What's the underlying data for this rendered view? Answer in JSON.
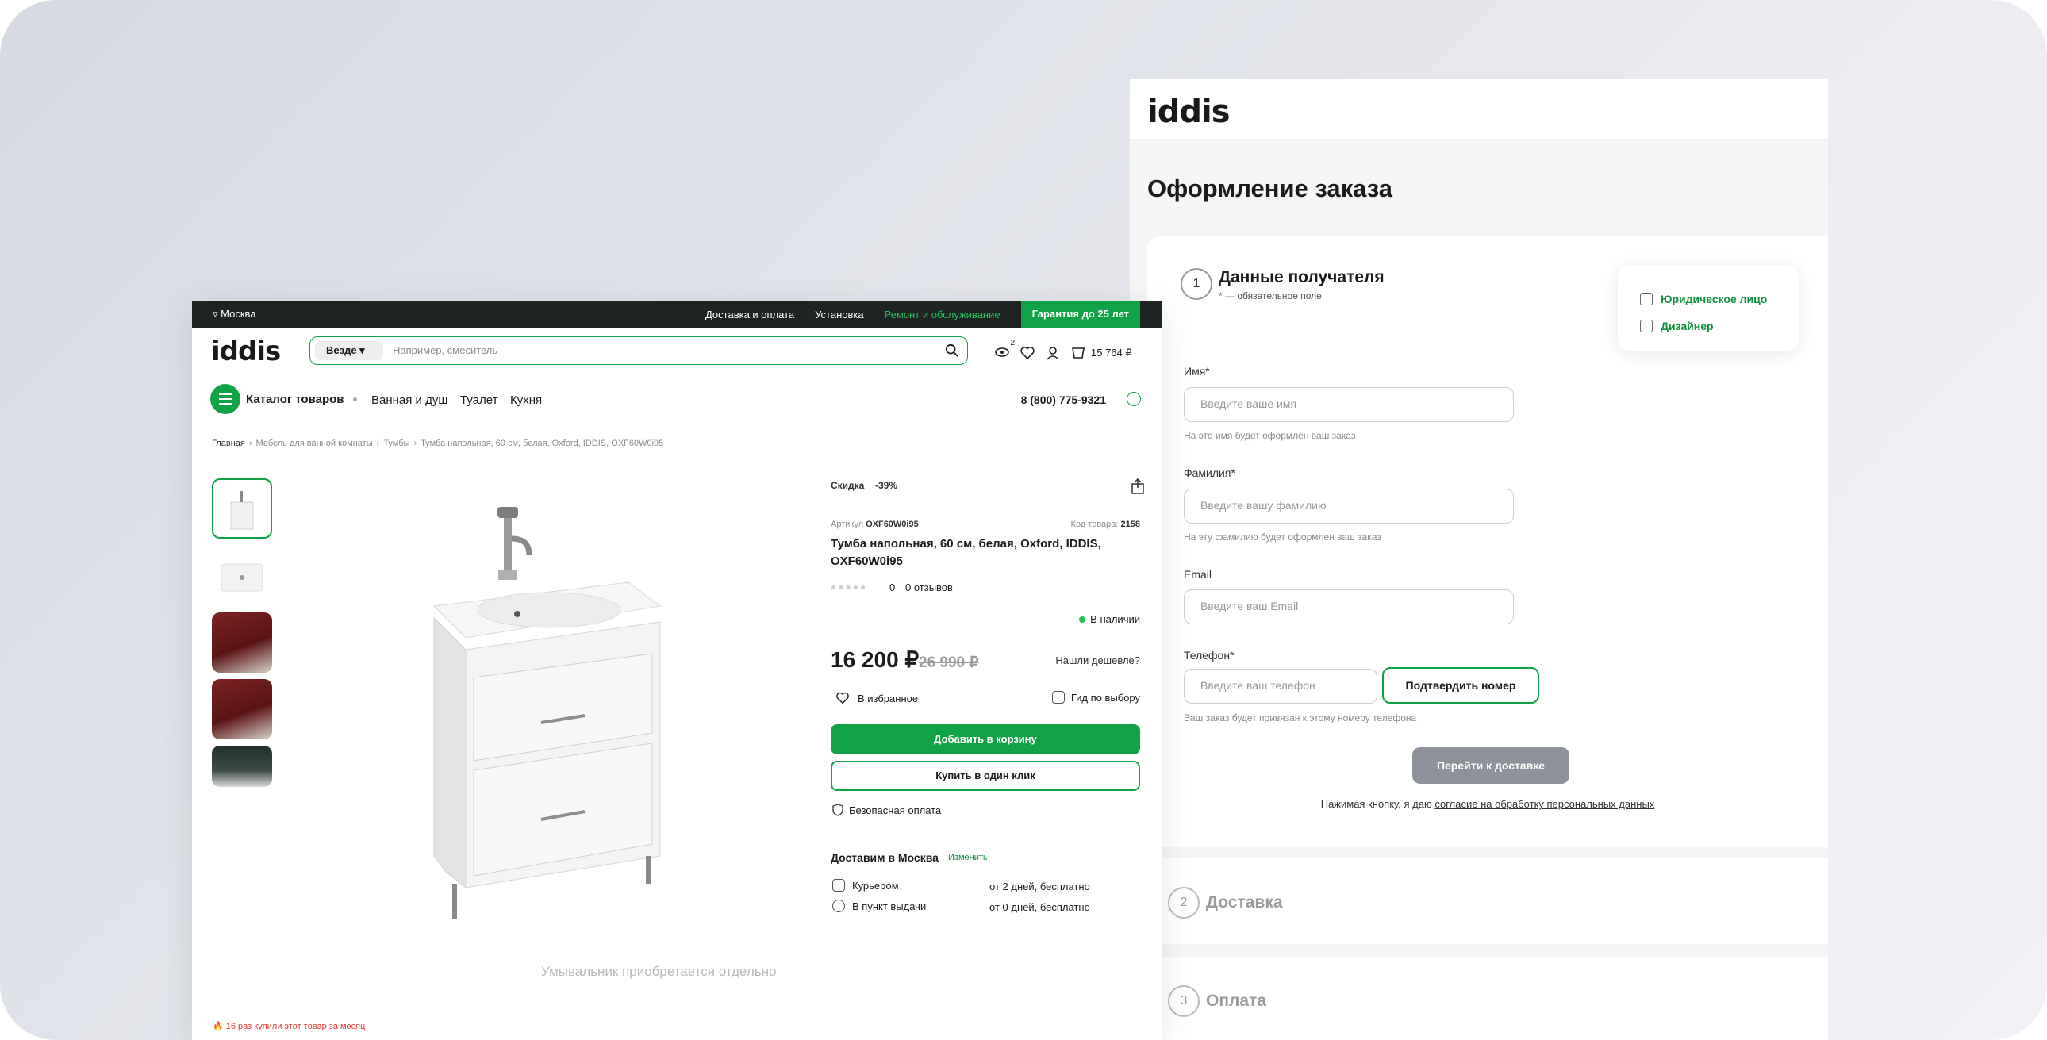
{
  "checkout": {
    "logo": "iddis",
    "title": "Оформление заказа",
    "step1": {
      "num": "1",
      "title": "Данные получателя",
      "required_note": "* — обязательное поле"
    },
    "entity": {
      "legal": "Юридическое лицо",
      "designer": "Дизайнер"
    },
    "fields": {
      "name_label": "Имя*",
      "name_placeholder": "Введите ваше имя",
      "name_hint": "На это имя будет оформлен ваш заказ",
      "surname_label": "Фамилия*",
      "surname_placeholder": "Введите вашу фамилию",
      "surname_hint": "На эту фамилию будет оформлен ваш заказ",
      "email_label": "Email",
      "email_placeholder": "Введите ваш Email",
      "phone_label": "Телефон*",
      "phone_placeholder": "Введите ваш телефон",
      "phone_hint": "Ваш заказ будет привязан к этому номеру телефона"
    },
    "confirm_button": "Подтвердить номер",
    "next_button": "Перейти к доставке",
    "consent_prefix": "Нажимая кнопку, я даю ",
    "consent_link": "согласие на обработку персональных данных",
    "step2": {
      "num": "2",
      "title": "Доставка"
    },
    "step3": {
      "num": "3",
      "title": "Оплата"
    }
  },
  "product_page": {
    "topbar": {
      "city": "Москва",
      "links": [
        "Доставка и оплата",
        "Установка"
      ],
      "service": "Ремонт и обслуживание",
      "warranty": "Гарантия до 25 лет"
    },
    "header": {
      "logo": "iddis",
      "search_scope": "Везде",
      "search_placeholder": "Например, смеситель",
      "compare_count": "2",
      "cart_total": "15 764 ₽"
    },
    "nav": {
      "catalog": "Каталог товаров",
      "links": [
        "Ванная и душ",
        "Туалет",
        "Кухня"
      ],
      "phone": "8 (800) 775-9321"
    },
    "breadcrumbs": [
      "Главная",
      "Мебель для ванной комнаты",
      "Тумбы",
      "Тумба напольная, 60 см, белая, Oxford, IDDIS, OXF60W0i95"
    ],
    "image_note": "Умывальник приобретается отдельно",
    "bought_note": "16 раз купили этот товар за месяц",
    "info": {
      "badge_sale": "Скидка",
      "badge_pct": "-39%",
      "article_label": "Артикул",
      "article": "OXF60W0i95",
      "code_label": "Код товара:",
      "code": "2158",
      "title": "Тумба напольная, 60 см, белая, Oxford, IDDIS, OXF60W0i95",
      "rating": "0",
      "reviews": "0 отзывов",
      "stock": "В наличии",
      "price": "16 200 ₽",
      "old_price": "26 990 ₽",
      "cheaper": "Нашли дешевле?",
      "favorite": "В избранное",
      "guide": "Гид по выбору",
      "add_to_cart": "Добавить в корзину",
      "one_click": "Купить в один клик",
      "safe_payment": "Безопасная оплата",
      "delivery_heading": "Доставим в Москва",
      "delivery_change": "Изменить",
      "courier": "Курьером",
      "courier_val": "от 2 дней, бесплатно",
      "pickup": "В пункт выдачи",
      "pickup_val": "от 0 дней, бесплатно"
    }
  }
}
